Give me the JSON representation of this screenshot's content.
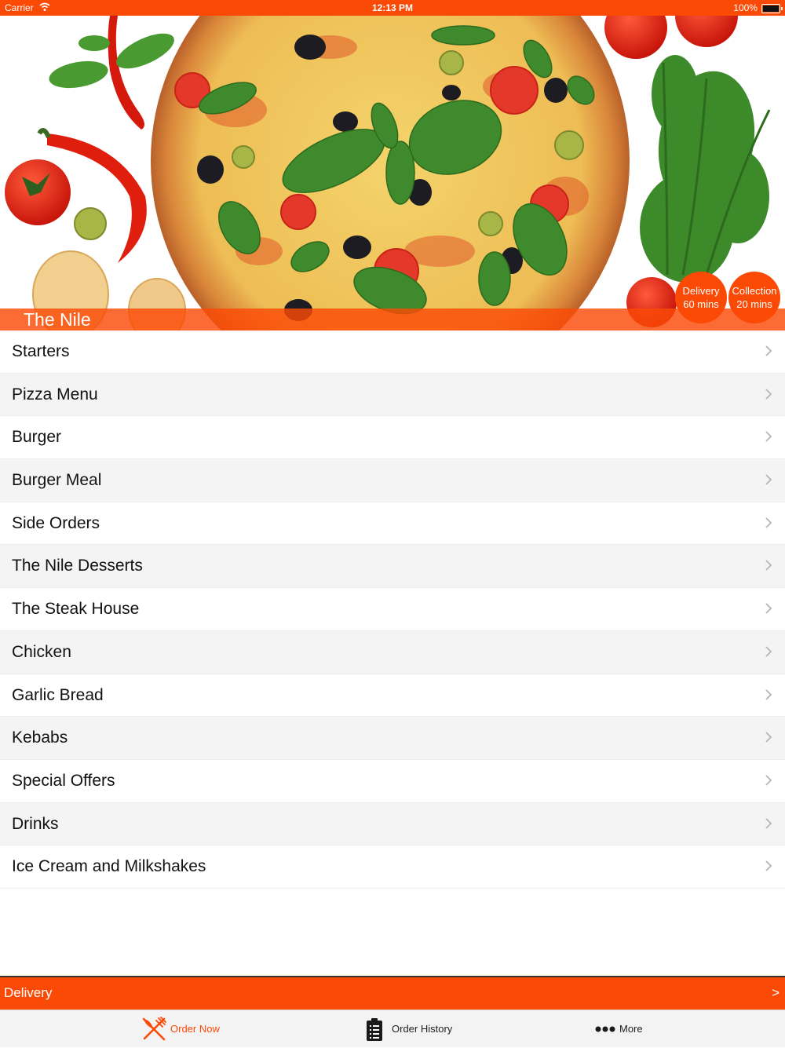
{
  "status_bar": {
    "carrier": "Carrier",
    "time": "12:13 PM",
    "battery": "100%"
  },
  "restaurant": {
    "name": "The Nile"
  },
  "badges": {
    "delivery": {
      "label": "Delivery",
      "time": "60 mins"
    },
    "collection": {
      "label": "Collection",
      "time": "20 mins"
    }
  },
  "menu": {
    "items": [
      {
        "label": "Starters"
      },
      {
        "label": "Pizza Menu"
      },
      {
        "label": "Burger"
      },
      {
        "label": "Burger Meal"
      },
      {
        "label": "Side Orders"
      },
      {
        "label": "The Nile Desserts"
      },
      {
        "label": "The Steak House"
      },
      {
        "label": "Chicken"
      },
      {
        "label": "Garlic Bread"
      },
      {
        "label": "Kebabs"
      },
      {
        "label": "Special Offers"
      },
      {
        "label": "Drinks"
      },
      {
        "label": "Ice Cream and Milkshakes"
      }
    ]
  },
  "delivery_bar": {
    "label": "Delivery",
    "arrow": ">"
  },
  "tabbar": {
    "tabs": [
      {
        "label": "Order Now",
        "icon": "fork-knife-icon",
        "active": true
      },
      {
        "label": "Order History",
        "icon": "clipboard-icon",
        "active": false
      },
      {
        "label": "More",
        "icon": "more-dots-icon",
        "active": false
      }
    ]
  },
  "colors": {
    "accent": "#fb4a06",
    "row_alt": "#f4f4f4"
  }
}
